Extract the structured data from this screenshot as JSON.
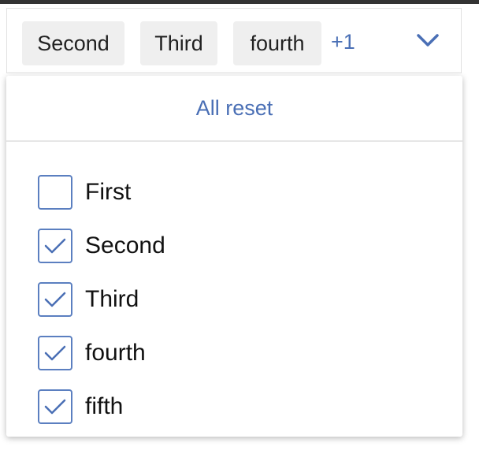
{
  "select": {
    "chips": [
      "Second",
      "Third",
      "fourth"
    ],
    "more_count": "+1",
    "toggle_icon": "chevron-down-icon"
  },
  "dropdown": {
    "reset_label": "All reset",
    "options": [
      {
        "label": "First",
        "checked": false
      },
      {
        "label": "Second",
        "checked": true
      },
      {
        "label": "Third",
        "checked": true
      },
      {
        "label": "fourth",
        "checked": true
      },
      {
        "label": "fifth",
        "checked": true
      }
    ]
  },
  "colors": {
    "accent": "#4a6fb5",
    "chip_background": "#efefef",
    "checkbox_border": "#5b7fc0"
  }
}
